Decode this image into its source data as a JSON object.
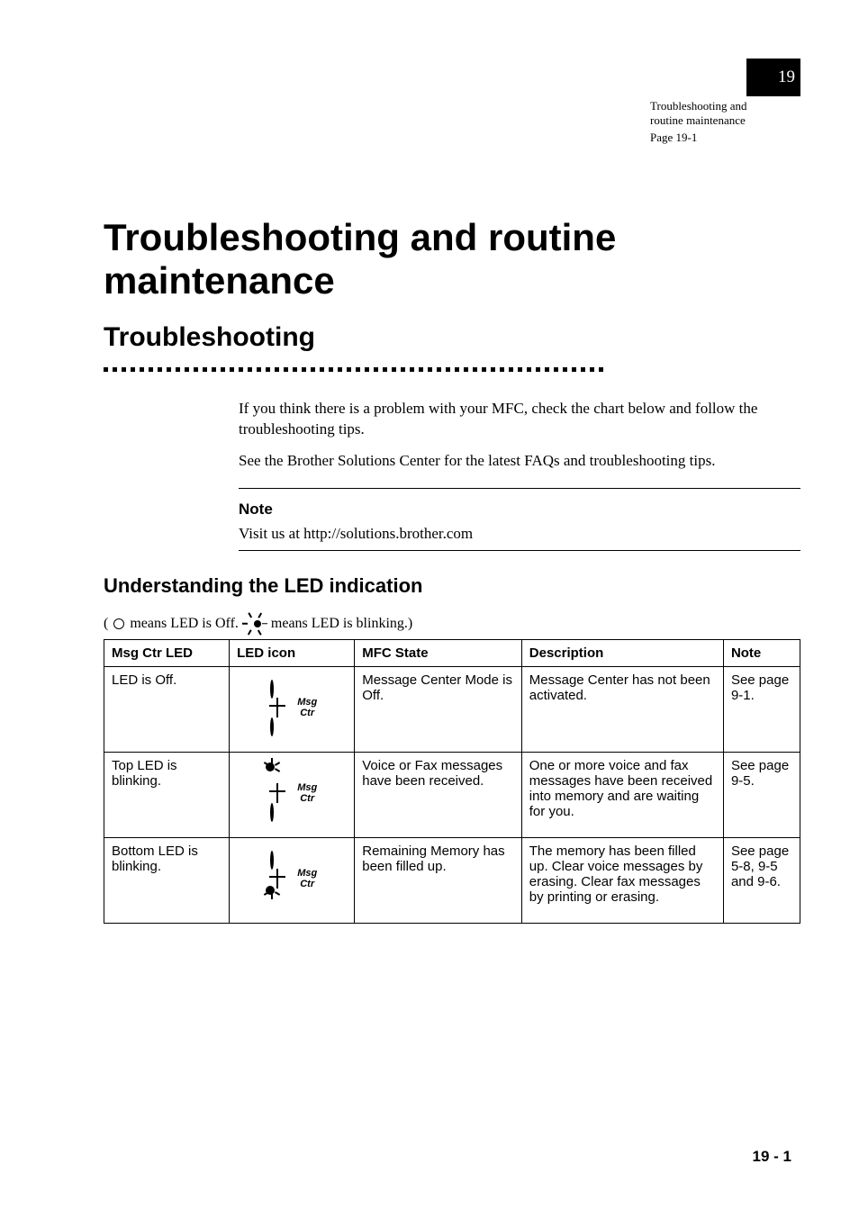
{
  "sidebox": {
    "line1": "Troubleshooting and",
    "line2": "routine maintenance",
    "page": "Page 19-1"
  },
  "tab": {
    "number": "19"
  },
  "heading": {
    "title": "Troubleshooting and routine maintenance",
    "subtitle": "Troubleshooting"
  },
  "intro": {
    "p1": "If you think there is a problem with your MFC, check the chart below and follow the troubleshooting tips.",
    "p2": "See the Brother Solutions Center for the latest FAQs and troubleshooting tips."
  },
  "note": {
    "title": "Note",
    "body": "Visit us at http://solutions.brother.com"
  },
  "ledsection": {
    "heading": "Understanding the LED indication",
    "caption_pre": "(",
    "caption_off": "means LED is Off.",
    "caption_flash": "means LED is blinking.)"
  },
  "chart_data": {
    "type": "table",
    "title": "LED indication table",
    "columns": [
      "Msg Ctr LED",
      "LED icon",
      "MFC State",
      "Description",
      "Note"
    ],
    "rows": [
      {
        "led_state": "LED is Off.",
        "icon": "both-off",
        "mfc_state": "Message Center Mode is Off.",
        "description": "Message Center has not been activated.",
        "note": "See page 9-1."
      },
      {
        "led_state": "Top LED is blinking.",
        "icon": "top-flash",
        "mfc_state": "Voice or Fax messages have been received.",
        "description": "One or more voice and fax messages have been received into memory and are waiting for you.",
        "note": "See page 9-5."
      },
      {
        "led_state": "Bottom LED is blinking.",
        "icon": "bot-flash",
        "mfc_state": "Remaining Memory has been filled up.",
        "description": "The memory has been filled up. Clear voice messages by erasing. Clear fax messages by printing or erasing.",
        "note": "See page 5-8, 9-5 and 9-6."
      }
    ]
  },
  "diag_label": "Msg Ctr",
  "footer": {
    "page": "19 - 1"
  }
}
